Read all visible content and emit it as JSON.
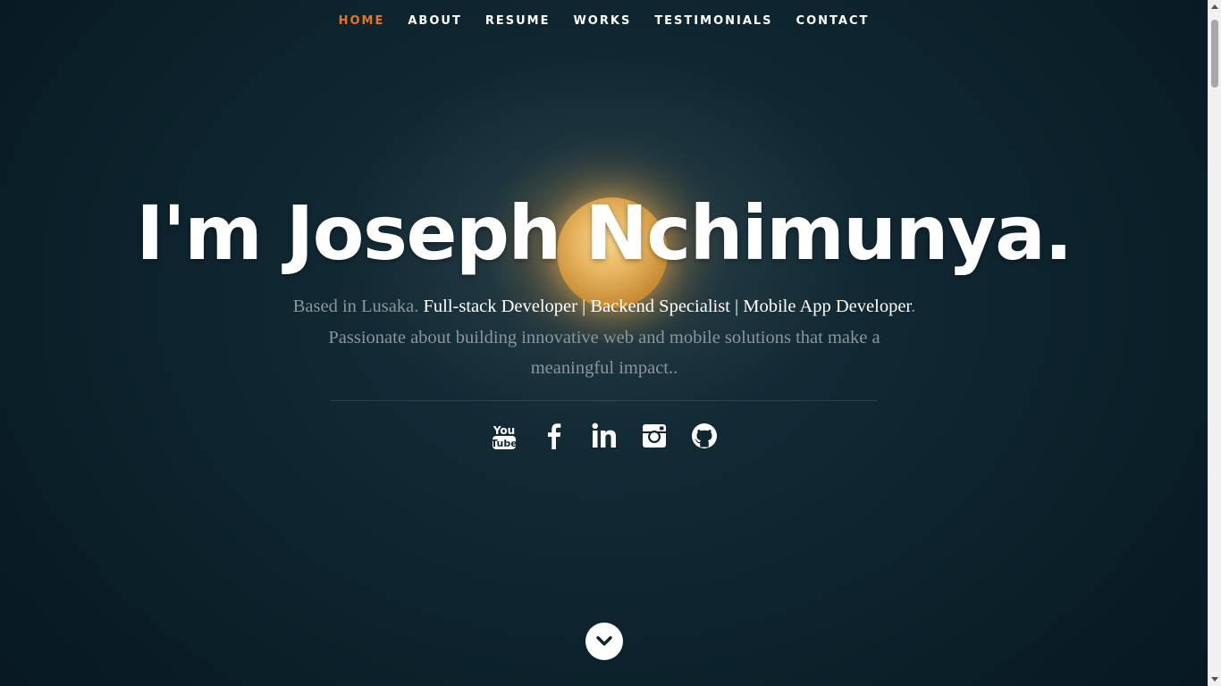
{
  "nav": {
    "items": [
      {
        "label": "HOME",
        "active": true
      },
      {
        "label": "ABOUT",
        "active": false
      },
      {
        "label": "RESUME",
        "active": false
      },
      {
        "label": "WORKS",
        "active": false
      },
      {
        "label": "TESTIMONIALS",
        "active": false
      },
      {
        "label": "CONTACT",
        "active": false
      }
    ],
    "active_color": "#e8741d"
  },
  "hero": {
    "headline": "I'm Joseph Nchimunya.",
    "intro_part1": "Based in Lusaka. ",
    "intro_highlight": "Full-stack Developer | Backend Specialist | Mobile App Developer",
    "intro_part2": ". Passionate about building innovative web and mobile solutions that make a meaningful impact..",
    "social": [
      {
        "icon": "youtube-icon"
      },
      {
        "icon": "facebook-icon"
      },
      {
        "icon": "linkedin-icon"
      },
      {
        "icon": "instagram-icon"
      },
      {
        "icon": "github-icon"
      }
    ],
    "scroll_icon": "chevron-down-icon"
  },
  "colors": {
    "background": "#0b1e27",
    "text": "#ffffff",
    "muted_text": "#8b969a",
    "accent": "#e8741d"
  }
}
